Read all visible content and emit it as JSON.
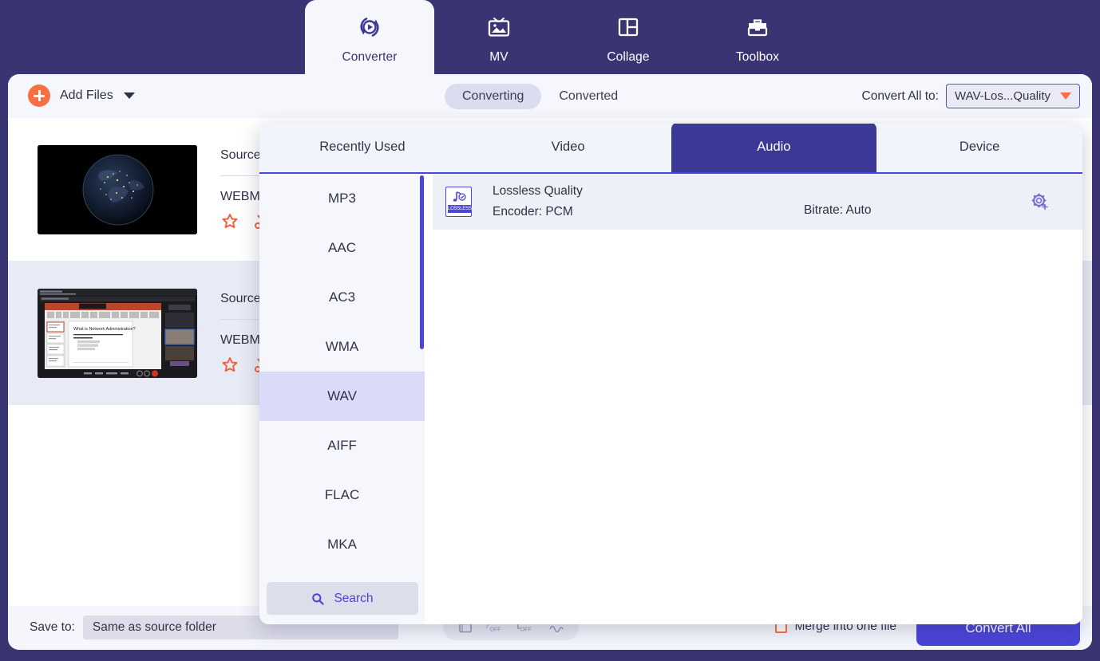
{
  "app": {
    "brand_color": "#3b3472",
    "accent_color": "#4b45d8",
    "orange_color": "#f96f42"
  },
  "topnav": {
    "items": [
      {
        "label": "Converter",
        "icon": "converter-icon",
        "active": true
      },
      {
        "label": "MV",
        "icon": "mv-icon",
        "active": false
      },
      {
        "label": "Collage",
        "icon": "collage-icon",
        "active": false
      },
      {
        "label": "Toolbox",
        "icon": "toolbox-icon",
        "active": false
      }
    ]
  },
  "toolbar": {
    "add_files_label": "Add Files",
    "add_files_icon": "plus-circle-icon",
    "add_files_caret": "chevron-down-icon",
    "tabs": [
      {
        "label": "Converting",
        "active": true
      },
      {
        "label": "Converted",
        "active": false
      }
    ],
    "convert_all_to_label": "Convert All to:",
    "convert_all_to_value": "WAV-Los...Quality",
    "convert_all_to_caret": "caret-down-icon"
  },
  "files": [
    {
      "source_label": "Source",
      "format_label": "WEBM",
      "thumbnail": "earth-at-night-thumbnail",
      "highlighted": false,
      "actions": [
        "effect-star-icon",
        "trim-icon"
      ]
    },
    {
      "source_label": "Source",
      "format_label": "WEBM",
      "thumbnail": "teams-presentation-thumbnail",
      "highlighted": true,
      "actions": [
        "effect-star-icon",
        "trim-icon"
      ]
    }
  ],
  "bottombar": {
    "save_to_label": "Save to:",
    "save_to_value": "Same as source folder",
    "mini_tools": [
      "folder-icon",
      "speed-off-icon",
      "volume-off-icon",
      "wave-icon"
    ],
    "merge_label": "Merge into one file",
    "convert_all_button": "Convert All"
  },
  "dropdown": {
    "tabs": [
      {
        "label": "Recently Used",
        "active": false
      },
      {
        "label": "Video",
        "active": false
      },
      {
        "label": "Audio",
        "active": true
      },
      {
        "label": "Device",
        "active": false
      }
    ],
    "formats": [
      {
        "label": "MP3",
        "selected": false
      },
      {
        "label": "AAC",
        "selected": false
      },
      {
        "label": "AC3",
        "selected": false
      },
      {
        "label": "WMA",
        "selected": false
      },
      {
        "label": "WAV",
        "selected": true
      },
      {
        "label": "AIFF",
        "selected": false
      },
      {
        "label": "FLAC",
        "selected": false
      },
      {
        "label": "MKA",
        "selected": false
      }
    ],
    "search_placeholder": "Search",
    "search_icon": "search-icon",
    "presets": [
      {
        "title": "Lossless Quality",
        "encoder": "Encoder: PCM",
        "bitrate": "Bitrate: Auto",
        "icon_tag": "LOSSLESS",
        "settings_icon": "gear-plus-icon"
      }
    ]
  }
}
